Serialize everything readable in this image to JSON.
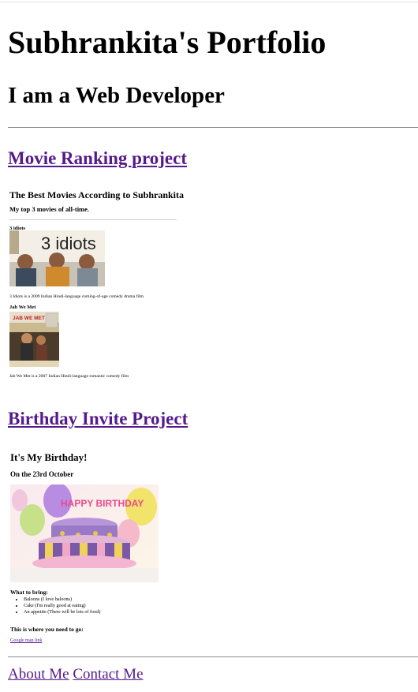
{
  "header": {
    "title": "Subhrankita's Portfolio",
    "subtitle": "I am a Web Developer"
  },
  "projects": [
    {
      "link_text": "Movie Ranking project",
      "preview": {
        "title": "The Best Movies According to Subhrankita",
        "subtitle": "My top 3 movies of all-time.",
        "movies": [
          {
            "name": "3 idiots",
            "poster_text": "3 idiots",
            "description": "3 Idiots is a 2009 Indian Hindi-language coming-of-age comedy drama film"
          },
          {
            "name": "Jab We Met",
            "poster_text": "JAB WE MET",
            "description": "Jab We Met is a 2007 Indian Hindi-language romantic comedy film"
          }
        ]
      }
    },
    {
      "link_text": "Birthday Invite Project",
      "preview": {
        "title": "It's My Birthday!",
        "subtitle": "On the 23rd October",
        "cake_text": "HAPPY BIRTHDAY",
        "bring_heading": "What to bring:",
        "bring_items": [
          "Baloons (I love baloons)",
          "Cake (I'm really good at eating)",
          "An appetite (There will be lots of food)"
        ],
        "where_heading": "This is where you need to go:",
        "map_link": "Google map link"
      }
    }
  ],
  "footer": {
    "about": "About Me",
    "contact": "Contact Me"
  },
  "colors": {
    "link": "#551a8b",
    "rule": "#8a8a8a"
  }
}
